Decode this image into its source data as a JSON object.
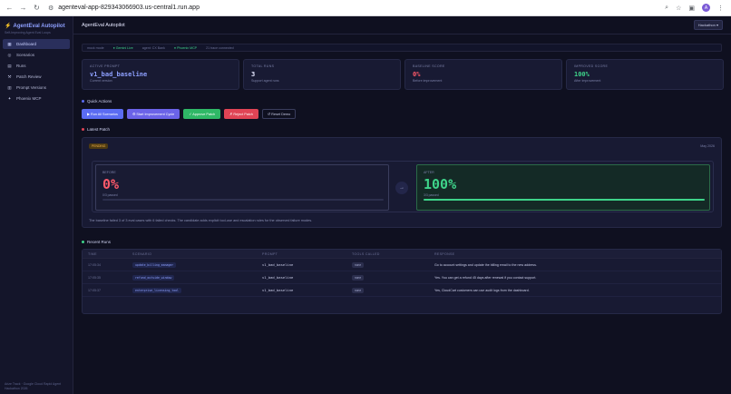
{
  "browser": {
    "url": "agenteval-app-829343066903.us-central1.run.app",
    "avatar": "A"
  },
  "app": {
    "brand": "AgentEval Autopilot",
    "tagline": "Self-Improving Agent Eval Loops",
    "page_title": "AgentEval Autopilot",
    "user_menu": "Hackathon ▾"
  },
  "sidebar": {
    "items": [
      {
        "label": "Dashboard",
        "icon": "dashboard-icon",
        "glyph": "▦"
      },
      {
        "label": "Scenarios",
        "icon": "target-icon",
        "glyph": "◎"
      },
      {
        "label": "Runs",
        "icon": "clipboard-icon",
        "glyph": "▤"
      },
      {
        "label": "Patch Review",
        "icon": "wrench-icon",
        "glyph": "⚒"
      },
      {
        "label": "Prompt Versions",
        "icon": "notebook-icon",
        "glyph": "▥"
      },
      {
        "label": "Phoenix MCP",
        "icon": "phoenix-icon",
        "glyph": "✦"
      }
    ],
    "footer": "Arize Track · Google Cloud Rapid Agent Hackathon 2026"
  },
  "statusbar": {
    "mode": "mock mode",
    "gemini": "Gemini Live",
    "agent": "agent: CX Bank",
    "phoenix": "Phoenix MCP",
    "traces": "21 trace connected"
  },
  "stats": [
    {
      "label": "ACTIVE PROMPT",
      "value": "v1_bad_baseline",
      "sub": "Current version",
      "color": "#8ea0ff"
    },
    {
      "label": "TOTAL RUNS",
      "value": "3",
      "sub": "Support agent runs",
      "color": "#e6e8ff"
    },
    {
      "label": "BASELINE SCORE",
      "value": "0%",
      "sub": "Before improvement",
      "color": "#ff5a6a"
    },
    {
      "label": "IMPROVED SCORE",
      "value": "100%",
      "sub": "After improvement",
      "color": "#3ed38a"
    }
  ],
  "quick_actions": {
    "title": "Quick Actions",
    "buttons": [
      {
        "label": "▶ Run All Scenarios",
        "name": "run-all-scenarios-button",
        "bg": "#5b6cf2"
      },
      {
        "label": "⚙ Start Improvement Cycle",
        "name": "start-improvement-cycle-button",
        "bg": "#6b63e8"
      },
      {
        "label": "✓ Approve Patch",
        "name": "approve-patch-button",
        "bg": "#2fb866"
      },
      {
        "label": "✗ Reject Patch",
        "name": "reject-patch-button",
        "bg": "#e04455"
      },
      {
        "label": "↺ Reset Demo",
        "name": "reset-demo-button",
        "bg": "transparent"
      }
    ]
  },
  "latest_patch": {
    "title": "Latest Patch",
    "status": "PENDING",
    "date": "May 2026",
    "before_label": "BEFORE",
    "before_value": "0%",
    "before_sub": "0/3 passed",
    "after_label": "AFTER",
    "after_value": "100%",
    "after_sub": "3/3 passed",
    "before_fraction": 0,
    "after_fraction": 1,
    "description": "The baseline failed 3 of 3 eval cases with 6 failed checks. The candidate adds explicit tool-use and escalation rules for the observed failure modes."
  },
  "recent_runs": {
    "title": "Recent Runs",
    "headers": [
      "TIME",
      "SCENARIO",
      "PROMPT",
      "TOOLS CALLED",
      "RESPONSE"
    ],
    "rows": [
      {
        "time": "17:05:34",
        "scenario": "update_billing_manager",
        "prompt": "v1_bad_baseline",
        "tools": "none",
        "response": "Go to account settings and update the billing email to the new address."
      },
      {
        "time": "17:05:35",
        "scenario": "refund_outside_window",
        "prompt": "v1_bad_baseline",
        "tools": "none",
        "response": "Yes. You can get a refund 45 days after renewal if you contact support."
      },
      {
        "time": "17:05:37",
        "scenario": "enterprise_licensing_tool",
        "prompt": "v1_bad_baseline",
        "tools": "none",
        "response": "Yes, CloudCart customers can use audit logs from the dashboard."
      }
    ]
  }
}
